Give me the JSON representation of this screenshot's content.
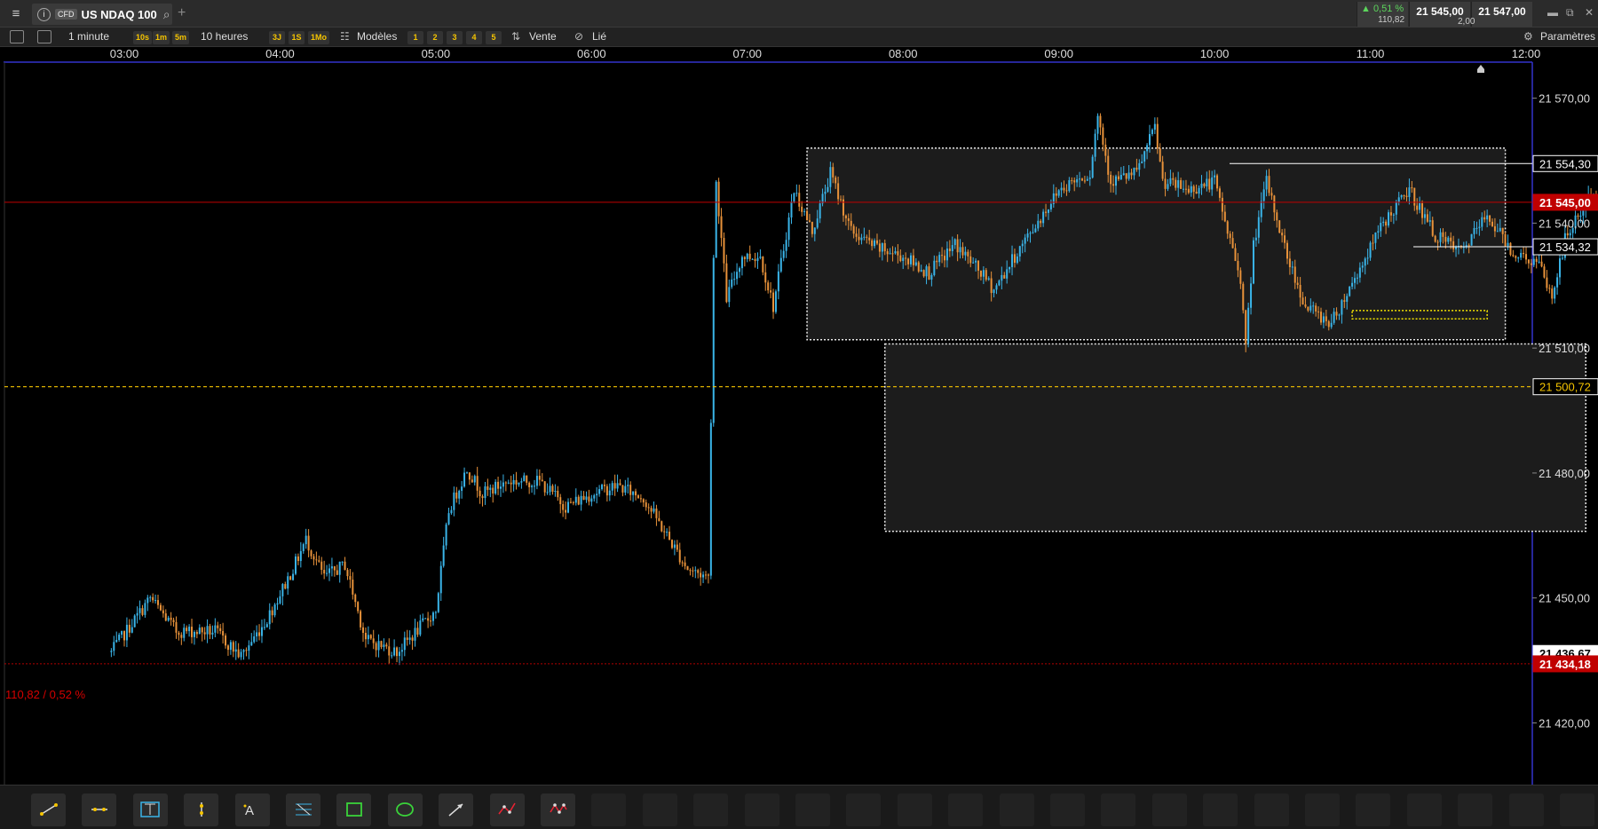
{
  "title_bar": {
    "instrument_type": "CFD",
    "instrument_name": "US NDAQ 100",
    "change_pct": "▲ 0,51 %",
    "change_abs": "110,82",
    "bid": "21 545,00",
    "ask": "21 547,00",
    "spread": "2,00",
    "icons": [
      "menu-icon",
      "info-icon",
      "search-icon",
      "add-tab-icon",
      "minimize-icon",
      "restore-icon",
      "close-icon"
    ]
  },
  "toolbar": {
    "timeframe": "1 minute",
    "quick_intervals": [
      "10s",
      "1m",
      "5m"
    ],
    "range": "10 heures",
    "quick_ranges": [
      "3J",
      "1S",
      "1Mo"
    ],
    "templates": "Modèles",
    "layouts": [
      "1",
      "2",
      "3",
      "4",
      "5"
    ],
    "sell": "Vente",
    "link": "Lié",
    "settings": "Paramètres"
  },
  "chart_data": {
    "type": "candlestick",
    "x_ticks": [
      "03:00",
      "04:00",
      "05:00",
      "06:00",
      "07:00",
      "08:00",
      "09:00",
      "10:00",
      "11:00",
      "12:00"
    ],
    "y_ticks": [
      "21 570,00",
      "21 540,00",
      "21 510,00",
      "21 480,00",
      "21 450,00",
      "21 420,00"
    ],
    "ylim": [
      21412,
      21581
    ],
    "current_price": {
      "label": "21 545,00",
      "value": 21545.0,
      "color": "#c00000"
    },
    "price_labels": [
      {
        "label": "21 554,30",
        "value": 21554.3
      },
      {
        "label": "21 534,32",
        "value": 21534.32
      },
      {
        "label": "21 500,72",
        "value": 21500.72,
        "color": "#f5c400"
      },
      {
        "label": "21 436,67",
        "value": 21436.67
      },
      {
        "label": "21 434,18",
        "value": 21434.18,
        "color": "#c00000"
      }
    ],
    "reference_line_text": "110,82 / 0,52 %",
    "up_color": "#3ab4e8",
    "down_color": "#e8923a",
    "path": [
      [
        "02:55",
        21437
      ],
      [
        "03:10",
        21450
      ],
      [
        "03:20",
        21442
      ],
      [
        "03:35",
        21442
      ],
      [
        "03:45",
        21436
      ],
      [
        "03:55",
        21445
      ],
      [
        "04:05",
        21457
      ],
      [
        "04:10",
        21464
      ],
      [
        "04:17",
        21455
      ],
      [
        "04:25",
        21458
      ],
      [
        "04:33",
        21440
      ],
      [
        "04:45",
        21437
      ],
      [
        "05:00",
        21447
      ],
      [
        "05:05",
        21471
      ],
      [
        "05:12",
        21481
      ],
      [
        "05:18",
        21475
      ],
      [
        "05:28",
        21478
      ],
      [
        "05:40",
        21478
      ],
      [
        "05:50",
        21472
      ],
      [
        "06:00",
        21475
      ],
      [
        "06:10",
        21477
      ],
      [
        "06:20",
        21474
      ],
      [
        "06:30",
        21464
      ],
      [
        "06:37",
        21457
      ],
      [
        "06:45",
        21455
      ],
      [
        "06:47",
        21532
      ],
      [
        "06:48",
        21550
      ],
      [
        "06:52",
        21522
      ],
      [
        "06:58",
        21532
      ],
      [
        "07:05",
        21532
      ],
      [
        "07:10",
        21520
      ],
      [
        "07:18",
        21548
      ],
      [
        "07:25",
        21538
      ],
      [
        "07:32",
        21552
      ],
      [
        "07:40",
        21538
      ],
      [
        "07:50",
        21534
      ],
      [
        "08:00",
        21532
      ],
      [
        "08:10",
        21528
      ],
      [
        "08:20",
        21535
      ],
      [
        "08:30",
        21528
      ],
      [
        "08:35",
        21524
      ],
      [
        "08:43",
        21532
      ],
      [
        "09:00",
        21548
      ],
      [
        "09:05",
        21550
      ],
      [
        "09:12",
        21552
      ],
      [
        "09:15",
        21566
      ],
      [
        "09:20",
        21550
      ],
      [
        "09:30",
        21552
      ],
      [
        "09:37",
        21563
      ],
      [
        "09:40",
        21550
      ],
      [
        "09:50",
        21548
      ],
      [
        "10:00",
        21550
      ],
      [
        "10:05",
        21538
      ],
      [
        "10:10",
        21527
      ],
      [
        "10:12",
        21510
      ],
      [
        "10:15",
        21535
      ],
      [
        "10:20",
        21550
      ],
      [
        "10:28",
        21532
      ],
      [
        "10:35",
        21520
      ],
      [
        "10:45",
        21516
      ],
      [
        "10:55",
        21528
      ],
      [
        "11:05",
        21540
      ],
      [
        "11:15",
        21548
      ],
      [
        "11:25",
        21537
      ],
      [
        "11:35",
        21533
      ],
      [
        "11:45",
        21542
      ],
      [
        "11:55",
        21533
      ],
      [
        "12:05",
        21530
      ],
      [
        "12:10",
        21522
      ],
      [
        "12:15",
        21536
      ],
      [
        "12:25",
        21547
      ],
      [
        "12:35",
        21540
      ],
      [
        "12:40",
        21541
      ]
    ],
    "zones": [
      {
        "name": "upper-range-box",
        "x0": "07:23",
        "x1": "11:52",
        "y0": 21512,
        "y1": 21558
      },
      {
        "name": "lower-range-box",
        "x0": "07:53",
        "x1": "12:23",
        "y0": 21466,
        "y1": 21511
      },
      {
        "name": "yellow-mini-zone",
        "x0": "10:53",
        "x1": "11:45",
        "y0": 21517,
        "y1": 21519
      }
    ]
  },
  "draw_tools": [
    "trend-line",
    "horizontal-line",
    "vertical-range",
    "vertical-line",
    "text-annotation",
    "fibonacci-levels",
    "rectangle",
    "ellipse",
    "arrow",
    "zigzag-path",
    "pattern"
  ]
}
